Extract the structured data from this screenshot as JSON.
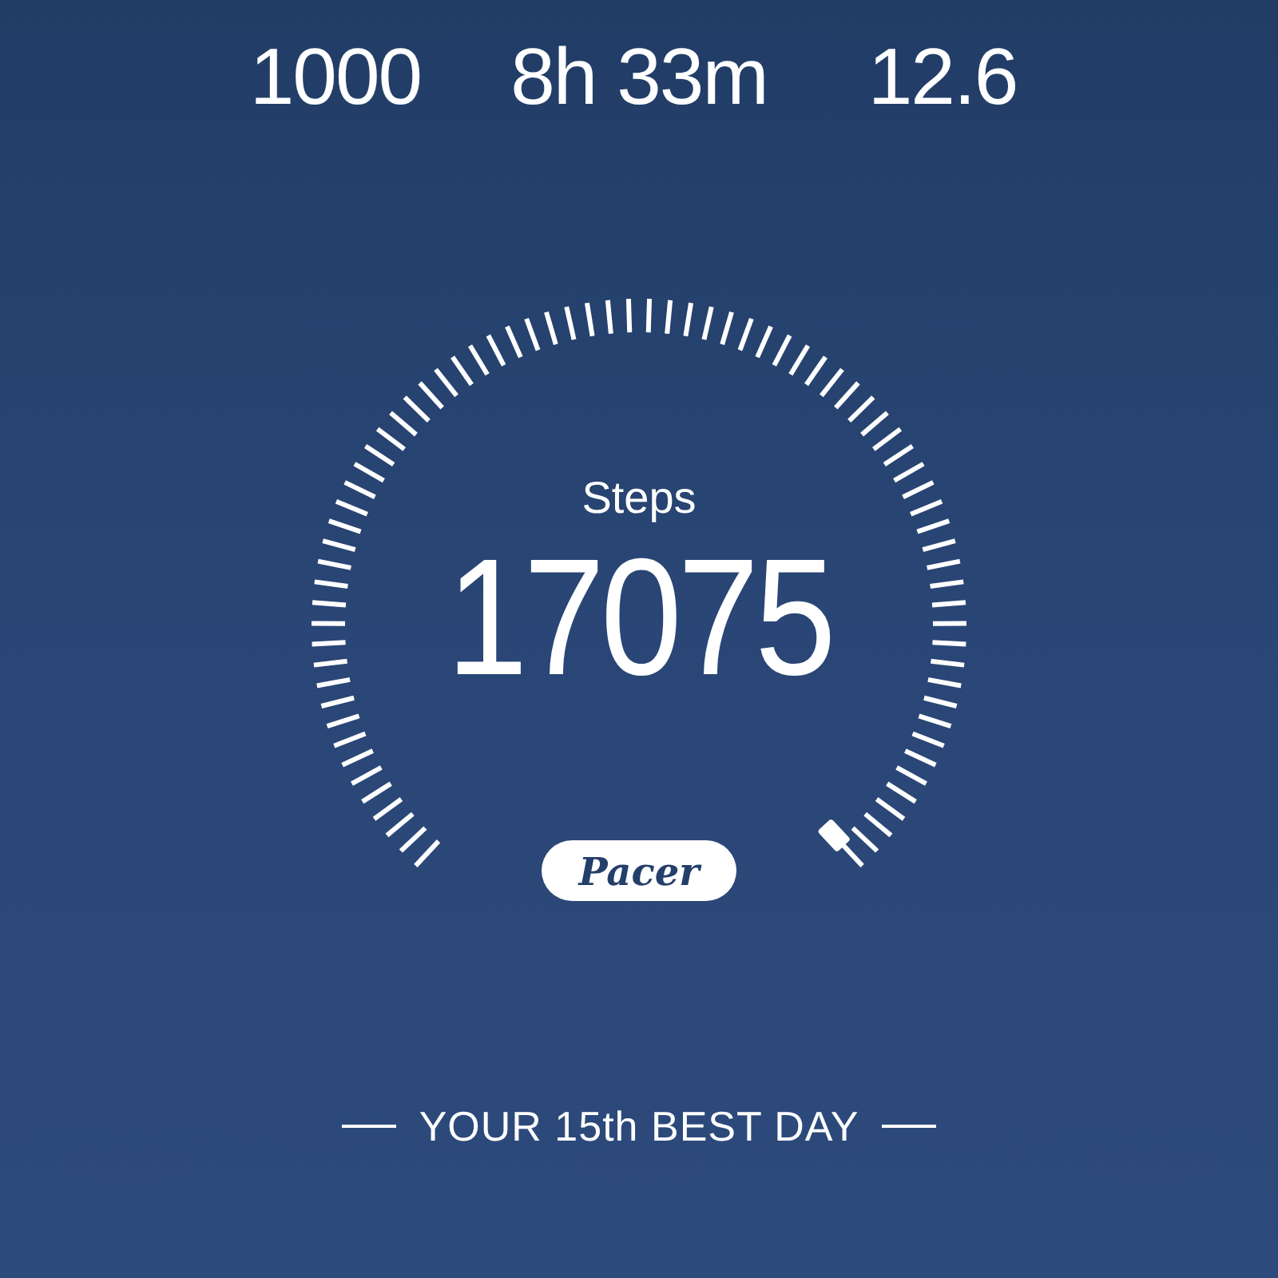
{
  "stats": [
    {
      "value": "1000"
    },
    {
      "value": "8h 33m"
    },
    {
      "value": "12.6"
    }
  ],
  "gauge": {
    "label": "Steps",
    "value": "17075"
  },
  "badge": {
    "text": "Pacer"
  },
  "footer": {
    "text": "YOUR 15th BEST DAY"
  }
}
